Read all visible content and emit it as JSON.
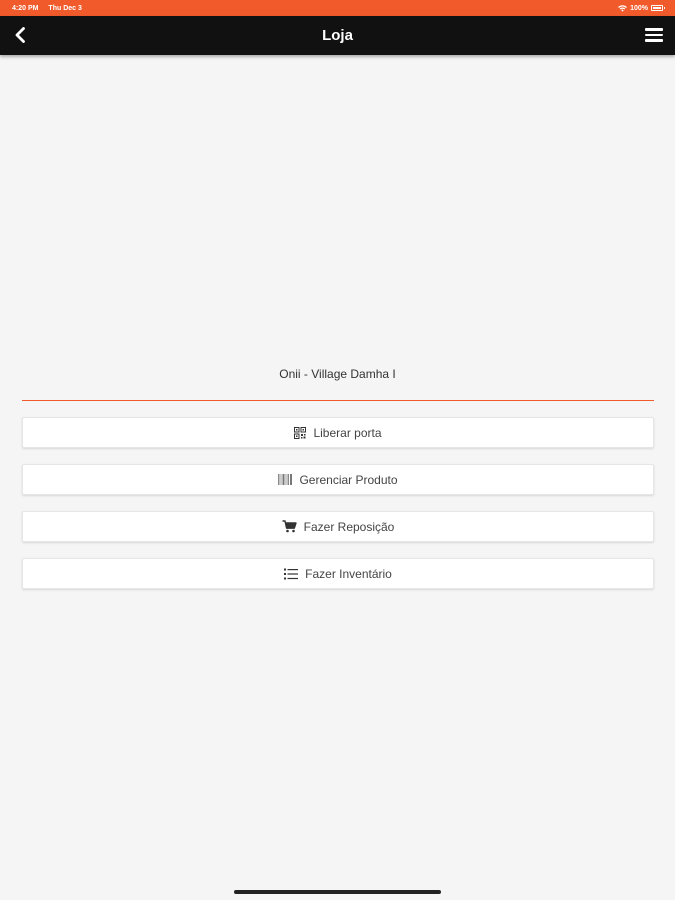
{
  "status_bar": {
    "time": "4:20 PM",
    "date": "Thu Dec 3",
    "wifi_icon": "wifi-icon",
    "battery_text": "100%",
    "background_color": "#f15a2b"
  },
  "nav": {
    "title": "Loja",
    "back_icon": "chevron-left-icon",
    "menu_icon": "hamburger-menu-icon",
    "background_color": "#111111"
  },
  "store": {
    "name": "Onii - Village Damha I",
    "accent_color": "#f15a2b"
  },
  "actions": [
    {
      "label": "Liberar porta",
      "icon": "qr-code-icon"
    },
    {
      "label": "Gerenciar Produto",
      "icon": "barcode-icon"
    },
    {
      "label": "Fazer Reposição",
      "icon": "cart-icon"
    },
    {
      "label": "Fazer Inventário",
      "icon": "list-icon"
    }
  ]
}
